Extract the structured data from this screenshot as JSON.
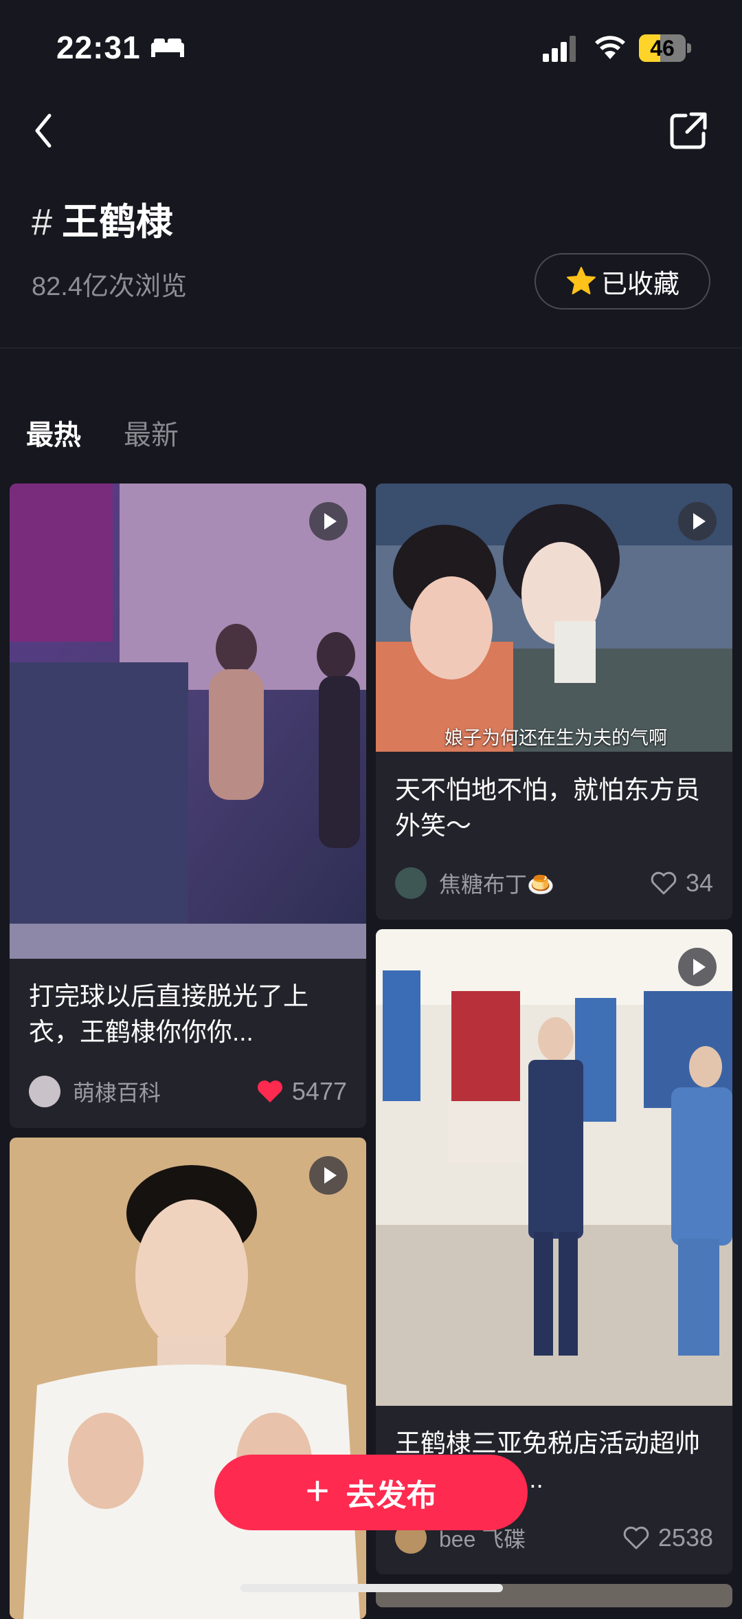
{
  "status_bar": {
    "time": "22:31",
    "battery": "46",
    "battery_level": 0.46
  },
  "topic": {
    "hash": "#",
    "name": "王鹤棣",
    "views": "82.4亿次浏览",
    "favorite_label": "已收藏"
  },
  "tabs": {
    "hot": "最热",
    "new": "最新"
  },
  "cards": [
    {
      "title": "打完球以后直接脱光了上衣，王鹤棣你你你...",
      "author": "萌棣百科",
      "likes": "5477",
      "liked": true
    },
    {
      "caption": "娘子为何还在生为夫的气啊",
      "title": "天不怕地不怕，就怕东方员外笑～",
      "author": "焦糖布丁🍮",
      "likes": "34",
      "liked": false
    },
    {
      "title": "王鹤棣三亚免税店活动超帅看帅哥出场...",
      "author": "bee 飞碟",
      "likes": "2538",
      "liked": false
    },
    {
      "title": ""
    }
  ],
  "publish": {
    "label": "去发布"
  },
  "colors": {
    "accent": "#ff2a4f",
    "background": "#17171f",
    "card": "#23232b"
  }
}
